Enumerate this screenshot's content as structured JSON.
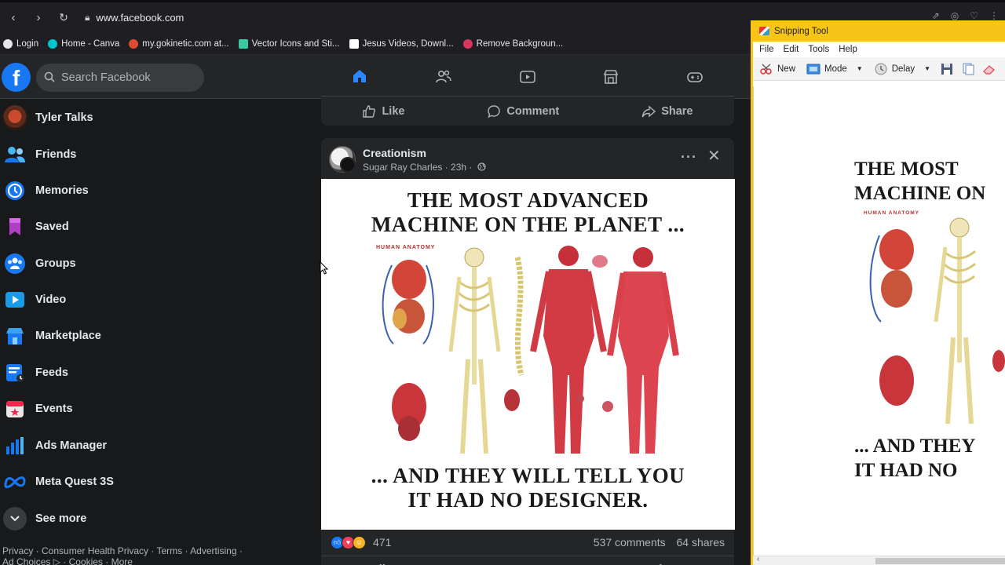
{
  "browser": {
    "url": "www.facebook.com",
    "bookmarks": [
      {
        "label": "Login",
        "color": "#e6e6e6"
      },
      {
        "label": "Home - Canva",
        "color": "#00c4cc"
      },
      {
        "label": "my.gokinetic.com at...",
        "color": "#e04a2f"
      },
      {
        "label": "Vector Icons and Sti...",
        "color": "#39c8a0"
      },
      {
        "label": "Jesus Videos, Downl...",
        "color": "#ffffff"
      },
      {
        "label": "Remove Backgroun...",
        "color": "#d9365b"
      }
    ]
  },
  "fb": {
    "logo": "f",
    "search_placeholder": "Search Facebook",
    "nav_tabs": [
      "home-icon",
      "friends-icon",
      "watch-icon",
      "marketplace-icon",
      "gaming-icon"
    ],
    "accent": "#2d88ff"
  },
  "sidebar": {
    "items": [
      {
        "label": "Tyler Talks",
        "icon": "profile-avatar"
      },
      {
        "label": "Friends",
        "icon": "friends-icon"
      },
      {
        "label": "Memories",
        "icon": "memories-icon"
      },
      {
        "label": "Saved",
        "icon": "saved-icon"
      },
      {
        "label": "Groups",
        "icon": "groups-icon"
      },
      {
        "label": "Video",
        "icon": "video-icon"
      },
      {
        "label": "Marketplace",
        "icon": "marketplace-icon"
      },
      {
        "label": "Feeds",
        "icon": "feeds-icon"
      },
      {
        "label": "Events",
        "icon": "events-icon"
      },
      {
        "label": "Ads Manager",
        "icon": "ads-manager-icon"
      },
      {
        "label": "Meta Quest 3S",
        "icon": "meta-icon"
      },
      {
        "label": "See more",
        "icon": "chevron-down-icon"
      }
    ],
    "footer_line1": "Privacy · Consumer Health Privacy · Terms · Advertising ·",
    "footer_line2": "Ad Choices ▷ · Cookies · More"
  },
  "feed": {
    "prev_actions": {
      "like": "Like",
      "comment": "Comment",
      "share": "Share"
    },
    "post": {
      "group": "Creationism",
      "author_meta": "Sugar Ray Charles · 23h ·",
      "image_text_top": "THE MOST ADVANCED\nMACHINE ON THE PLANET ...",
      "image_caption": "HUMAN ANATOMY",
      "image_text_bottom": "... AND THEY WILL TELL YOU\nIT HAD NO DESIGNER.",
      "reaction_count": "471",
      "comments": "537 comments",
      "shares": "64 shares"
    }
  },
  "snipping_tool": {
    "title": "Snipping Tool",
    "menu": [
      "File",
      "Edit",
      "Tools",
      "Help"
    ],
    "tools": {
      "new": "New",
      "mode": "Mode",
      "delay": "Delay"
    },
    "preview_top": "THE MOST\nMACHINE ON",
    "preview_caption": "HUMAN ANATOMY",
    "preview_bottom": "... AND THEY\nIT HAD NO"
  }
}
